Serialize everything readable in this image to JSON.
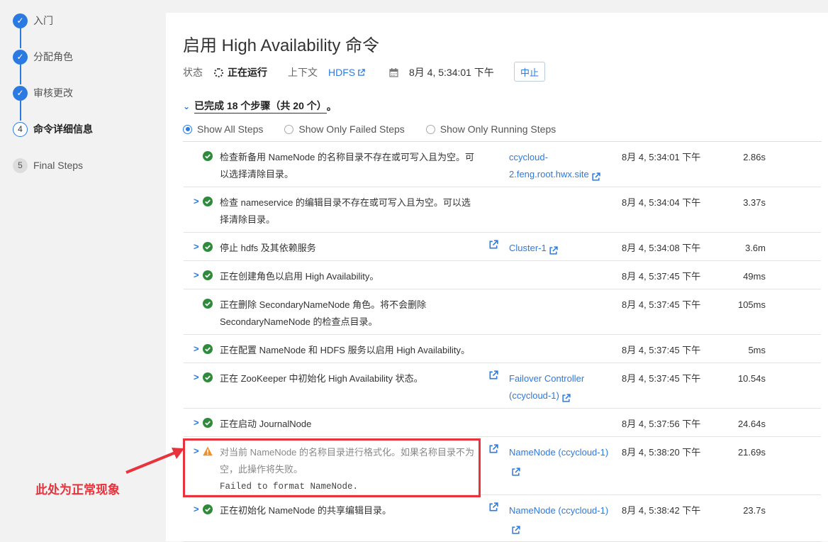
{
  "sidebar": {
    "steps": [
      {
        "num": "",
        "label": "入门",
        "state": "done"
      },
      {
        "num": "",
        "label": "分配角色",
        "state": "done"
      },
      {
        "num": "",
        "label": "审核更改",
        "state": "done"
      },
      {
        "num": "4",
        "label": "命令详细信息",
        "state": "current"
      },
      {
        "num": "5",
        "label": "Final Steps",
        "state": "pending"
      }
    ]
  },
  "header": {
    "title": "启用 High Availability 命令",
    "status_label": "状态",
    "status_value": "正在运行",
    "context_label": "上下文",
    "context_link": "HDFS",
    "calendar_icon": "calendar-icon",
    "time": "8月 4, 5:34:01 下午",
    "abort_label": "中止"
  },
  "summary": {
    "text": "已完成 18 个步骤（共 20 个）",
    "suffix": "。"
  },
  "filters": {
    "options": [
      "Show All Steps",
      "Show Only Failed Steps",
      "Show Only Running Steps"
    ],
    "selected": "Show All Steps"
  },
  "steps": [
    {
      "expand": false,
      "status": "ok",
      "desc1": "检查新备用 NameNode 的名称目录不存在或可写入且为空。可",
      "desc2": "以选择清除目录。",
      "ext": false,
      "ctx1": "ccycloud-",
      "ctx2": "2.feng.root.hwx.site",
      "time": "8月 4, 5:34:01 下午",
      "dur": "2.86s"
    },
    {
      "expand": true,
      "status": "ok",
      "desc1": "检查 nameservice 的编辑目录不存在或可写入且为空。可以选",
      "desc2": "择清除目录。",
      "ext": false,
      "ctx1": "",
      "ctx2": "",
      "time": "8月 4, 5:34:04 下午",
      "dur": "3.37s"
    },
    {
      "expand": true,
      "status": "ok",
      "desc1": "停止 hdfs 及其依赖服务",
      "desc2": "",
      "ext": true,
      "ctx1": "Cluster-1",
      "ctx2": "",
      "time": "8月 4, 5:34:08 下午",
      "dur": "3.6m"
    },
    {
      "expand": true,
      "status": "ok",
      "desc1": "正在创建角色以启用 High Availability。",
      "desc2": "",
      "ext": false,
      "ctx1": "",
      "ctx2": "",
      "time": "8月 4, 5:37:45 下午",
      "dur": "49ms"
    },
    {
      "expand": false,
      "status": "ok",
      "desc1": "正在删除 SecondaryNameNode 角色。将不会删除",
      "desc2": "SecondaryNameNode 的检查点目录。",
      "ext": false,
      "ctx1": "",
      "ctx2": "",
      "time": "8月 4, 5:37:45 下午",
      "dur": "105ms"
    },
    {
      "expand": true,
      "status": "ok",
      "desc1": "正在配置 NameNode 和 HDFS 服务以启用 High Availability。",
      "desc2": "",
      "ext": false,
      "ctx1": "",
      "ctx2": "",
      "time": "8月 4, 5:37:45 下午",
      "dur": "5ms"
    },
    {
      "expand": true,
      "status": "ok",
      "desc1": "正在 ZooKeeper 中初始化 High Availability 状态。",
      "desc2": "",
      "ext": true,
      "ctx1": "Failover Controller",
      "ctx2": "(ccycloud-1)",
      "time": "8月 4, 5:37:45 下午",
      "dur": "10.54s"
    },
    {
      "expand": true,
      "status": "ok",
      "desc1": "正在启动 JournalNode",
      "desc2": "",
      "ext": false,
      "ctx1": "",
      "ctx2": "",
      "time": "8月 4, 5:37:56 下午",
      "dur": "24.64s"
    },
    {
      "expand": true,
      "status": "warn",
      "desc1": "对当前 NameNode 的名称目录进行格式化。如果名称目录不为",
      "desc2": "空，此操作将失败。",
      "desc3": "Failed to format NameNode.",
      "ext": true,
      "ctx1": "NameNode (ccycloud-1)",
      "ctx2": "",
      "time": "8月 4, 5:38:20 下午",
      "dur": "21.69s"
    },
    {
      "expand": true,
      "status": "ok",
      "desc1": "正在初始化 NameNode 的共享编辑目录。",
      "desc2": "",
      "ext": true,
      "ctx1": "NameNode (ccycloud-1)",
      "ctx2": "",
      "time": "8月 4, 5:38:42 下午",
      "dur": "23.7s"
    }
  ],
  "annotation": {
    "text": "此处为正常现象",
    "color": "#e8323c"
  },
  "colors": {
    "accent": "#2a7ae2",
    "ok": "#2e8b3a",
    "warn": "#f0902a"
  }
}
